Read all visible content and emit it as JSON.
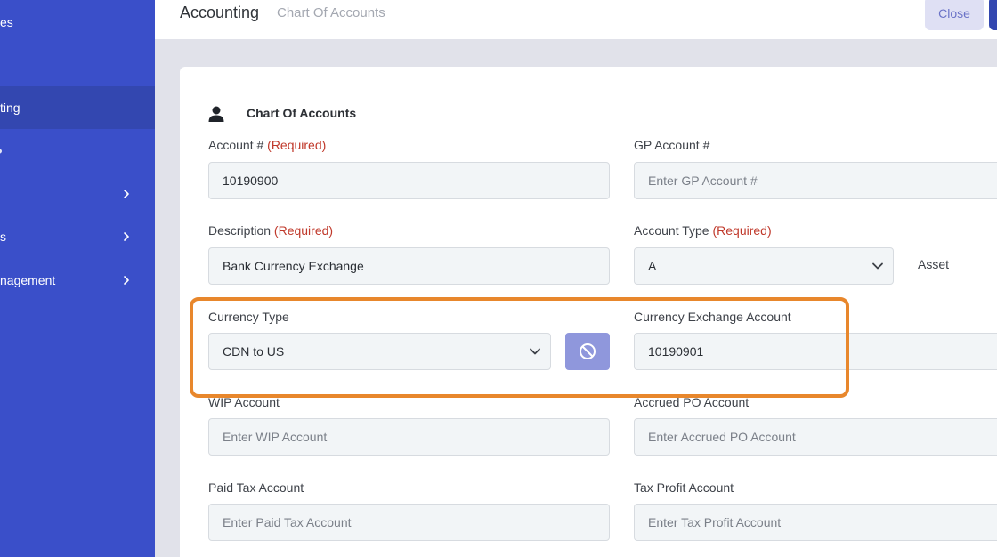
{
  "sidebar": {
    "items": [
      {
        "label": "es"
      },
      {
        "label": "ting"
      },
      {
        "label": "s"
      },
      {
        "label": "nagement"
      }
    ]
  },
  "header": {
    "title": "Accounting",
    "breadcrumb": "Chart Of Accounts",
    "close_label": "Close"
  },
  "form": {
    "section_title": "Chart Of Accounts",
    "required_text": "(Required)",
    "account_number": {
      "label": "Account #",
      "value": "10190900"
    },
    "gp_account": {
      "label": "GP Account #",
      "placeholder": "Enter GP Account #"
    },
    "description": {
      "label": "Description",
      "value": "Bank Currency Exchange"
    },
    "account_type": {
      "label": "Account Type",
      "value": "A",
      "display_text": "Asset"
    },
    "currency_type": {
      "label": "Currency Type",
      "value": "CDN to US"
    },
    "currency_exchange_account": {
      "label": "Currency Exchange Account",
      "value": "10190901"
    },
    "wip_account": {
      "label": "WIP Account",
      "placeholder": "Enter WIP Account"
    },
    "accrued_po_account": {
      "label": "Accrued PO Account",
      "placeholder": "Enter Accrued PO Account"
    },
    "paid_tax_account": {
      "label": "Paid Tax Account",
      "placeholder": "Enter Paid Tax Account"
    },
    "tax_profit_account": {
      "label": "Tax Profit Account",
      "placeholder": "Enter Tax Profit Account"
    }
  },
  "colors": {
    "sidebar_bg": "#3a4fc9",
    "sidebar_active": "#3347b0",
    "required": "#c0392b",
    "highlight_border": "#e8872c",
    "clear_button": "#8f97dc"
  },
  "icons": [
    "person-icon",
    "chevron-right-icon",
    "chevron-down-icon",
    "ban-icon"
  ]
}
